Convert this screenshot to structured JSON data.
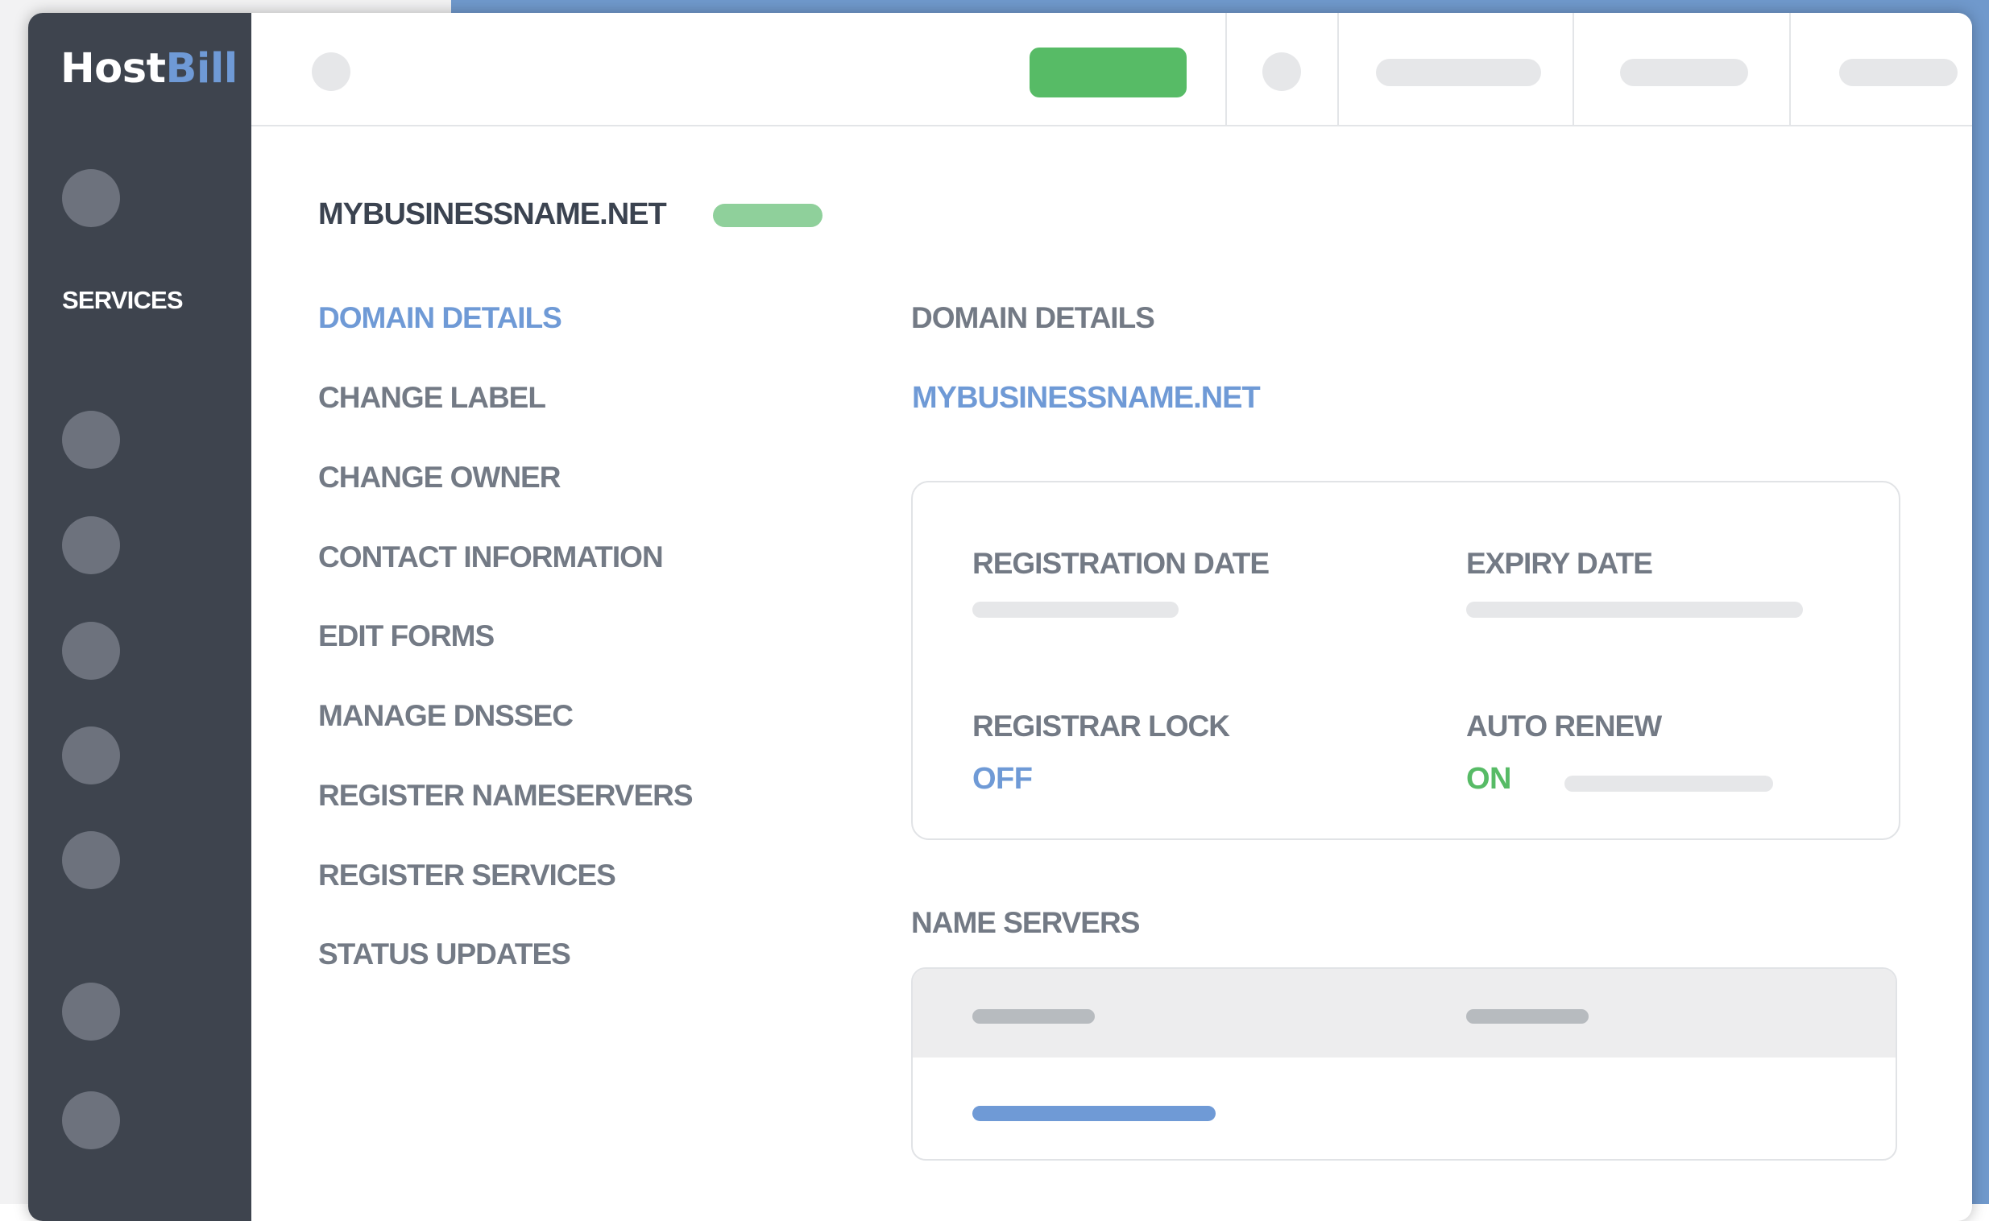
{
  "app": {
    "logo_part1": "Host",
    "logo_part2": "Bill"
  },
  "sidebar": {
    "active_label": "SERVICES"
  },
  "page": {
    "domain_title": "MYBUSINESSNAME.NET"
  },
  "menu": {
    "items": [
      "DOMAIN DETAILS",
      "CHANGE LABEL",
      "CHANGE OWNER",
      "CONTACT INFORMATION",
      "EDIT FORMS",
      "MANAGE DNSSEC",
      "REGISTER NAMESERVERS",
      "REGISTER SERVICES",
      "STATUS UPDATES"
    ],
    "active_index": 0
  },
  "details": {
    "section_title": "DOMAIN DETAILS",
    "domain_name": "MYBUSINESSNAME.NET",
    "registration_date_label": "REGISTRATION DATE",
    "expiry_date_label": "EXPIRY DATE",
    "registrar_lock_label": "REGISTRAR LOCK",
    "registrar_lock_value": "OFF",
    "auto_renew_label": "AUTO RENEW",
    "auto_renew_value": "ON"
  },
  "nameservers": {
    "section_title": "NAME SERVERS"
  },
  "colors": {
    "sidebar_bg": "#3e444e",
    "accent_blue": "#6f9ad6",
    "accent_green": "#57bb66",
    "status_badge": "#8fd09b",
    "text_muted": "#737a85",
    "text_dark": "#3b4350",
    "placeholder": "#e6e7e9"
  }
}
